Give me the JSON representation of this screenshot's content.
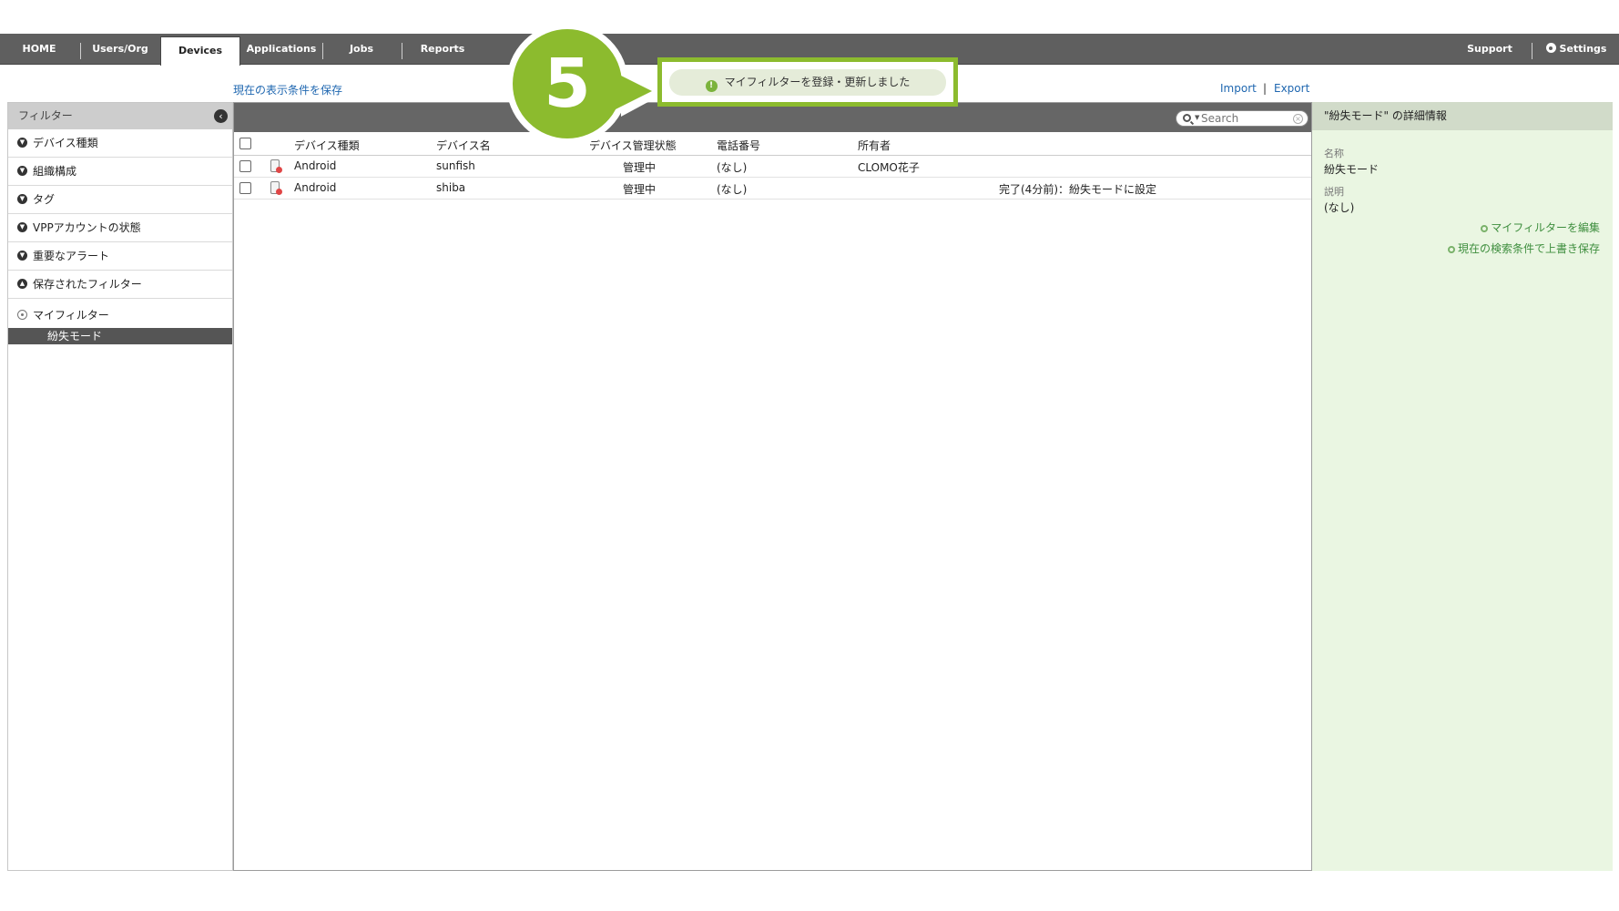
{
  "nav": {
    "tabs": [
      "HOME",
      "Users/Org",
      "Devices",
      "Applications",
      "Jobs",
      "Reports"
    ],
    "support": "Support",
    "settings": "Settings"
  },
  "toolbar": {
    "save_view": "現在の表示条件を保存",
    "import": "Import",
    "export": "Export",
    "separator": "|"
  },
  "sidebar": {
    "header": "フィルター",
    "items": [
      "デバイス種類",
      "組織構成",
      "タグ",
      "VPPアカウントの状態",
      "重要なアラート",
      "保存されたフィルター"
    ],
    "myfilter_label": "マイフィルター",
    "myfilter_items": [
      "紛失モード"
    ]
  },
  "search": {
    "placeholder": "Search"
  },
  "table": {
    "headers": [
      "デバイス種類",
      "デバイス名",
      "デバイス管理状態",
      "電話番号",
      "所有者"
    ],
    "rows": [
      {
        "type": "Android",
        "name": "sunfish",
        "status": "管理中",
        "phone": "(なし)",
        "owner": "CLOMO花子",
        "note": ""
      },
      {
        "type": "Android",
        "name": "shiba",
        "status": "管理中",
        "phone": "(なし)",
        "owner": "",
        "note": "完了(4分前)：紛失モードに設定"
      }
    ]
  },
  "detail": {
    "header": "\"紛失モード\" の詳細情報",
    "name_label": "名称",
    "name_value": "紛失モード",
    "desc_label": "説明",
    "desc_value": "(なし)",
    "edit_link": "マイフィルターを編集",
    "overwrite_link": "現在の検索条件で上書き保存"
  },
  "notice": {
    "message": "マイフィルターを登録・更新しました"
  },
  "callout": {
    "step": "5"
  },
  "colors": {
    "accent_green": "#8cbb2e",
    "nav_bg": "#5f5f5f",
    "link_blue": "#1f67b0"
  }
}
